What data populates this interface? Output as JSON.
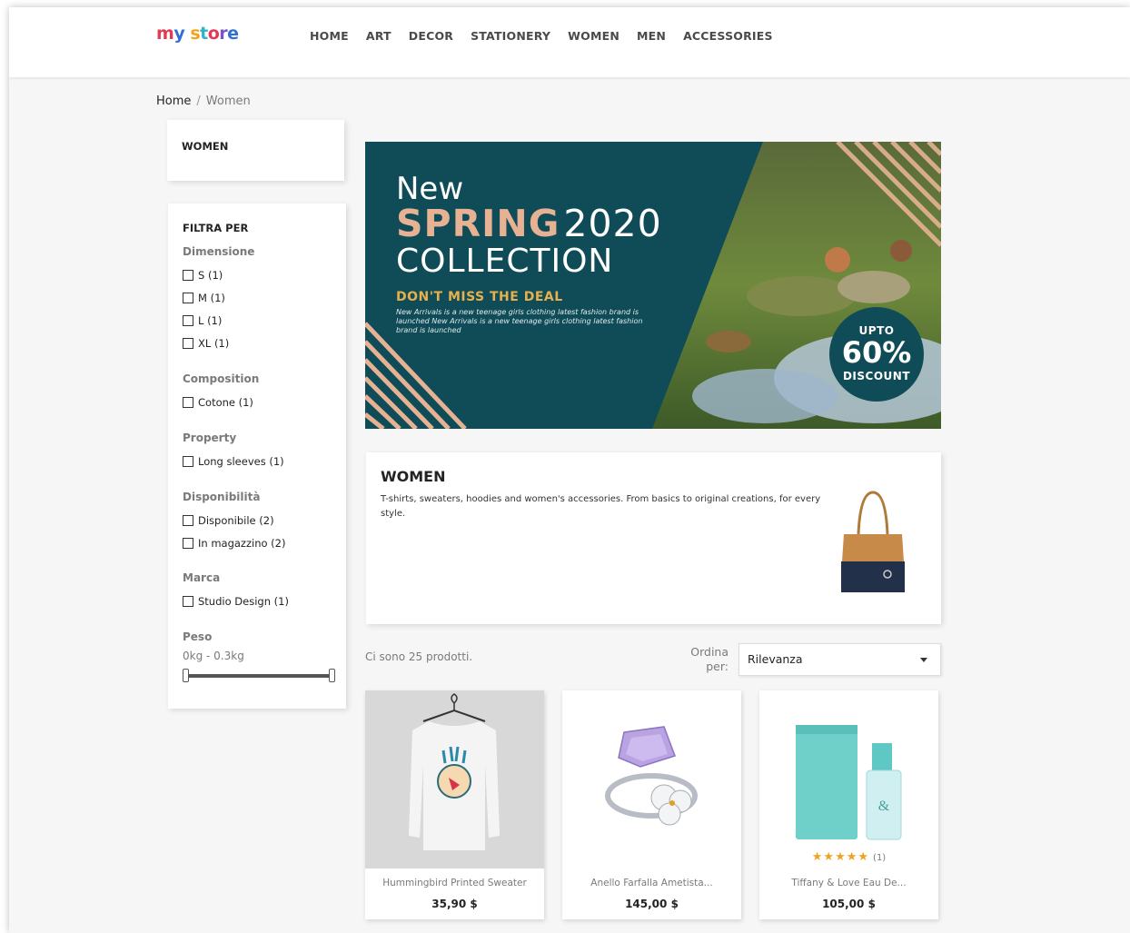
{
  "header": {
    "logo": {
      "part1": "my",
      "part2": "store"
    },
    "nav": [
      "HOME",
      "ART",
      "DECOR",
      "STATIONERY",
      "WOMEN",
      "MEN",
      "ACCESSORIES"
    ]
  },
  "breadcrumb": {
    "home": "Home",
    "separator": "/",
    "current": "Women"
  },
  "category_box": {
    "title": "WOMEN"
  },
  "filters": {
    "title": "FILTRA PER",
    "groups": [
      {
        "title": "Dimensione",
        "items": [
          "S (1)",
          "M (1)",
          "L (1)",
          "XL (1)"
        ]
      },
      {
        "title": "Composition",
        "items": [
          "Cotone (1)"
        ]
      },
      {
        "title": "Property",
        "items": [
          "Long sleeves (1)"
        ]
      },
      {
        "title": "Disponibilità",
        "items": [
          "Disponibile (2)",
          "In magazzino (2)"
        ]
      },
      {
        "title": "Marca",
        "items": [
          "Studio Design (1)"
        ]
      },
      {
        "title": "Peso",
        "range": "0kg - 0.3kg"
      }
    ]
  },
  "banner": {
    "line1": "New",
    "spring": "SPRING",
    "year": "2020",
    "collection": "COLLECTION",
    "deal": "DON'T MISS THE DEAL",
    "desc": "New Arrivals is a new teenage girls clothing latest fashion brand is launched New Arrivals is a new teenage girls clothing latest fashion brand is launched",
    "badge_top": "UPTO",
    "badge_pct": "60%",
    "badge_bottom": "DISCOUNT"
  },
  "category": {
    "title": "WOMEN",
    "description": "T-shirts, sweaters, hoodies and women's accessories. From basics to original creations, for every style."
  },
  "listing": {
    "count": "Ci sono 25 prodotti.",
    "sort_label": "Ordina per:",
    "sort_value": "Rilevanza"
  },
  "products": [
    {
      "name": "Hummingbird Printed Sweater",
      "price": "35,90 $"
    },
    {
      "name": "Anello Farfalla Ametista...",
      "price": "145,00 $"
    },
    {
      "name": "Tiffany & Love Eau De...",
      "price": "105,00 $",
      "stars": "★★★★★",
      "reviews": "(1)"
    }
  ],
  "colors": {
    "banner_teal": "#0f4c58",
    "banner_peach": "#e6b293",
    "deal_gold": "#e8b04b",
    "star": "#f0a41e"
  }
}
